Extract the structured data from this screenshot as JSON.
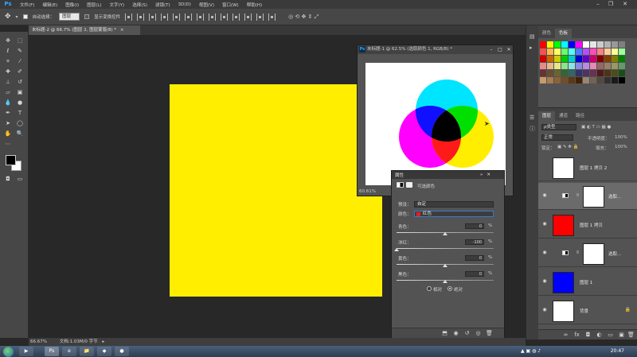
{
  "app": {
    "logo": "Ps"
  },
  "menu": [
    "文件(F)",
    "编辑(E)",
    "图像(I)",
    "图层(L)",
    "文字(Y)",
    "选择(S)",
    "滤镜(T)",
    "3D(D)",
    "视图(V)",
    "窗口(W)",
    "帮助(H)"
  ],
  "window_controls": {
    "minimize": "–",
    "maximize": "❐",
    "close": "✕"
  },
  "options": {
    "auto_select_label": "自动选择：",
    "auto_select_value": "图层",
    "show_transform_label": "显示变换控件"
  },
  "document": {
    "tab_title": "未标题-2 @ 66.7% (图层 2, 图层蒙版/8) *",
    "tab_close": "×",
    "canvas_color": "#ffee00"
  },
  "float_window": {
    "title": "未标题-1 @ 62.5% (选取颜色 1, RGB/8) *",
    "ps": "Ps",
    "zoom": "60.61%"
  },
  "properties": {
    "tab": "属性",
    "panel_title": "可选颜色",
    "preset_label": "预设：",
    "preset_value": "自定",
    "colors_label": "颜色：",
    "colors_value": "红色",
    "sliders": [
      {
        "label": "青色：",
        "value": "0",
        "unit": "%",
        "position": 0.5
      },
      {
        "label": "洋红：",
        "value": "-100",
        "unit": "%",
        "position": 0.0
      },
      {
        "label": "黄色：",
        "value": "0",
        "unit": "%",
        "position": 0.5
      },
      {
        "label": "黑色：",
        "value": "0",
        "unit": "%",
        "position": 0.5
      }
    ],
    "radio_relative": "相对",
    "radio_absolute": "绝对",
    "radio_selected": "absolute"
  },
  "swatches": {
    "tabs": [
      "颜色",
      "色板"
    ],
    "active_tab": "色板",
    "colors": [
      "#ff0000",
      "#ffff00",
      "#00ff00",
      "#00ffff",
      "#0000ff",
      "#ff00ff",
      "#ffffff",
      "#e6e6e6",
      "#cccccc",
      "#b3b3b3",
      "#999999",
      "#808080",
      "#ff4d4d",
      "#ffb84d",
      "#ffff66",
      "#66ff66",
      "#4dffff",
      "#4d79ff",
      "#b84dff",
      "#ff4db8",
      "#ff8080",
      "#ffcc99",
      "#ffff99",
      "#99ff99",
      "#cc0000",
      "#cc6600",
      "#cccc00",
      "#00cc00",
      "#00cccc",
      "#0000cc",
      "#6600cc",
      "#cc0066",
      "#800000",
      "#804000",
      "#808000",
      "#008000",
      "#e68a8a",
      "#e6b88a",
      "#e6e68a",
      "#8ae68a",
      "#8ae6e6",
      "#8a8ae6",
      "#b88ae6",
      "#e68ab8",
      "#996666",
      "#998066",
      "#999966",
      "#669966",
      "#663333",
      "#664d33",
      "#666633",
      "#336633",
      "#336666",
      "#333366",
      "#4d3366",
      "#663350",
      "#4d1a1a",
      "#4d331a",
      "#4d4d1a",
      "#1a4d1a",
      "#c69c6d",
      "#a67c52",
      "#8c6239",
      "#754c24",
      "#603913",
      "#42210b",
      "#998675",
      "#736357",
      "#534741",
      "#362f2d",
      "#1a1a1a",
      "#000000"
    ]
  },
  "layers": {
    "tabs": [
      "图层",
      "通道",
      "路径"
    ],
    "active_tab": "图层",
    "kind_label": "ρ类型",
    "blend_mode": "正常",
    "opacity_label": "不透明度：",
    "opacity_value": "100%",
    "lock_label": "锁定：",
    "fill_label": "填充：",
    "fill_value": "100%",
    "items": [
      {
        "name": "图层 1 拷贝 2",
        "thumb": "#ffffff",
        "adjustment": false,
        "visible": false
      },
      {
        "name": "选取...",
        "thumb": "#ffffff",
        "adjustment": true,
        "visible": true
      },
      {
        "name": "图层 1 拷贝",
        "thumb": "#ff0000",
        "adjustment": false,
        "visible": true
      },
      {
        "name": "选取...",
        "thumb": "#ffffff",
        "adjustment": true,
        "visible": true
      },
      {
        "name": "图层 1",
        "thumb": "#0000ff",
        "adjustment": false,
        "visible": true
      },
      {
        "name": "背景",
        "thumb": "#ffffff",
        "adjustment": false,
        "visible": true
      }
    ]
  },
  "status": {
    "zoom": "66.67%",
    "doc": "文档:1.03M/0 字节"
  },
  "taskbar": {
    "clock": "20:47"
  }
}
